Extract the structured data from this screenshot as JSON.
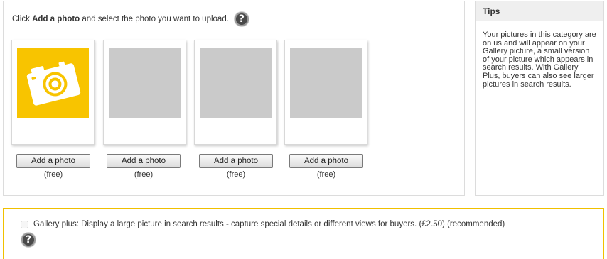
{
  "upload": {
    "instruction_prefix": "Click ",
    "instruction_bold": "Add a photo",
    "instruction_suffix": " and select the photo you want to upload.",
    "help_icon": "?",
    "slots": [
      {
        "button_label": "Add a photo",
        "price_label": "(free)",
        "icon": "camera-icon"
      },
      {
        "button_label": "Add a photo",
        "price_label": "(free)"
      },
      {
        "button_label": "Add a photo",
        "price_label": "(free)"
      },
      {
        "button_label": "Add a photo",
        "price_label": "(free)"
      }
    ],
    "accent_color": "#f8c400"
  },
  "tips": {
    "title": "Tips",
    "body": "Your pictures in this category are on us and will appear on your Gallery picture, a small version of your picture which appears in search results. With Gallery Plus, buyers can also see larger pictures in search results."
  },
  "gallery_plus": {
    "label": "Gallery plus: Display a large picture in search results - capture special details or different views for buyers. (£2.50) (recommended)",
    "checked": false,
    "help_icon": "?",
    "border_color": "#f0c000"
  }
}
